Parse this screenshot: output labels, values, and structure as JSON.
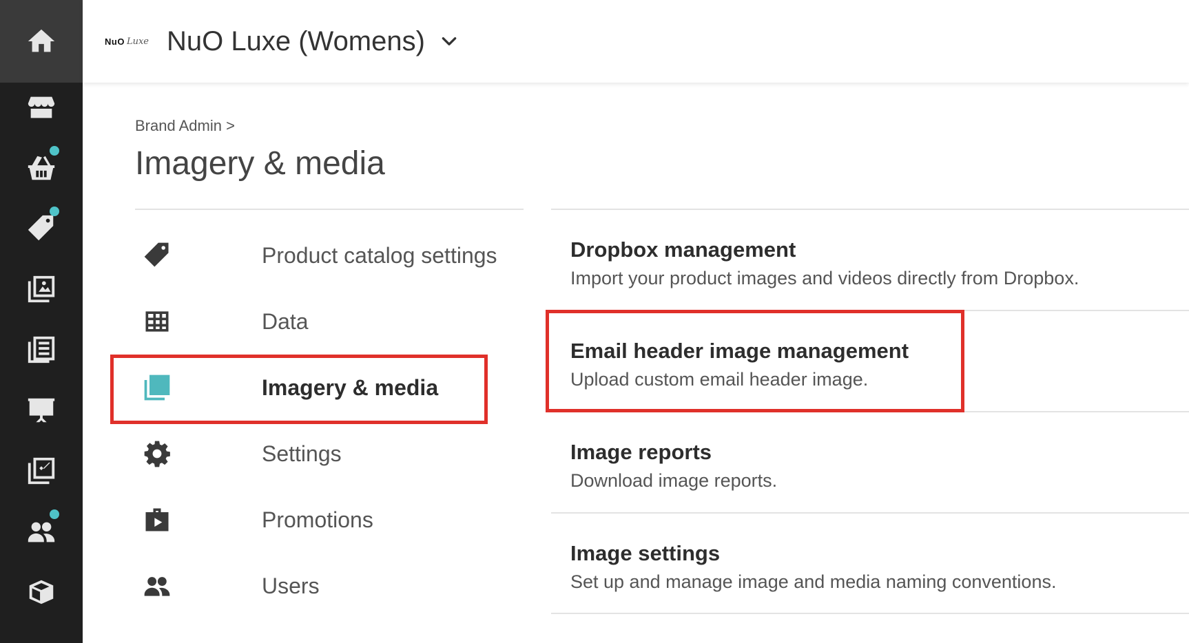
{
  "rail": {
    "items": [
      {
        "icon": "home-icon",
        "badge": false
      },
      {
        "icon": "storefront-icon",
        "badge": false
      },
      {
        "icon": "basket-icon",
        "badge": true
      },
      {
        "icon": "tag-icon",
        "badge": true
      },
      {
        "icon": "image-gallery-icon",
        "badge": false
      },
      {
        "icon": "list-document-icon",
        "badge": false
      },
      {
        "icon": "presentation-icon",
        "badge": false
      },
      {
        "icon": "checklist-icon",
        "badge": false
      },
      {
        "icon": "users-icon",
        "badge": true
      },
      {
        "icon": "box-icon",
        "badge": false
      }
    ],
    "badge_color": "#4fc3c8"
  },
  "header": {
    "logo_text_bold": "NuO",
    "logo_text_script": "Luxe",
    "brand_name": "NuO Luxe (Womens)"
  },
  "breadcrumb": "Brand Admin >",
  "page_title": "Imagery & media",
  "menu": {
    "items": [
      {
        "label": "Product catalog settings",
        "icon": "tag-icon",
        "active": false
      },
      {
        "label": "Data",
        "icon": "table-icon",
        "active": false
      },
      {
        "label": "Imagery & media",
        "icon": "image-gallery-icon",
        "active": true
      },
      {
        "label": "Settings",
        "icon": "gear-icon",
        "active": false
      },
      {
        "label": "Promotions",
        "icon": "promotions-bag-icon",
        "active": false
      },
      {
        "label": "Users",
        "icon": "users-icon",
        "active": false
      }
    ],
    "active_color": "#4fb8bd"
  },
  "options": [
    {
      "title": "Dropbox management",
      "description": "Import your product images and videos directly from Dropbox."
    },
    {
      "title": "Email header image management",
      "description": "Upload custom email header image."
    },
    {
      "title": "Image reports",
      "description": "Download image reports."
    },
    {
      "title": "Image settings",
      "description": "Set up and manage image and media naming conventions."
    }
  ],
  "highlight_color": "#e0302a"
}
